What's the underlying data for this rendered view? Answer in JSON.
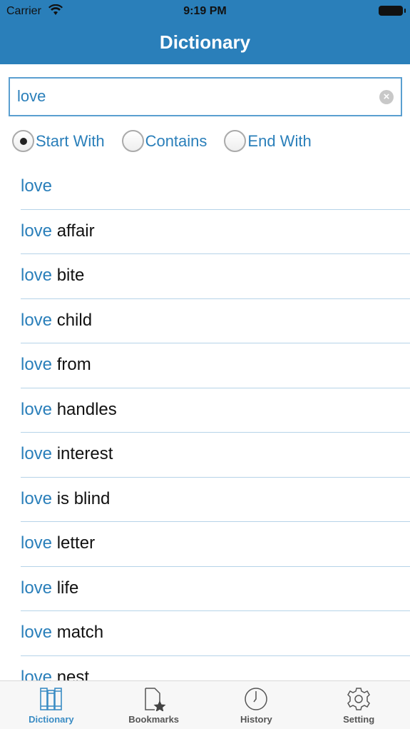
{
  "status": {
    "carrier": "Carrier",
    "time": "9:19 PM"
  },
  "header": {
    "title": "Dictionary"
  },
  "search": {
    "value": "love"
  },
  "filters": [
    {
      "label": "Start With",
      "selected": true
    },
    {
      "label": "Contains",
      "selected": false
    },
    {
      "label": "End With",
      "selected": false
    }
  ],
  "results": [
    {
      "prefix": "love",
      "rest": ""
    },
    {
      "prefix": "love",
      "rest": " affair"
    },
    {
      "prefix": "love",
      "rest": " bite"
    },
    {
      "prefix": "love",
      "rest": " child"
    },
    {
      "prefix": "love",
      "rest": " from"
    },
    {
      "prefix": "love",
      "rest": " handles"
    },
    {
      "prefix": "love",
      "rest": " interest"
    },
    {
      "prefix": "love",
      "rest": " is blind"
    },
    {
      "prefix": "love",
      "rest": " letter"
    },
    {
      "prefix": "love",
      "rest": " life"
    },
    {
      "prefix": "love",
      "rest": " match"
    },
    {
      "prefix": "love",
      "rest": " nest"
    }
  ],
  "tabs": [
    {
      "label": "Dictionary",
      "icon": "books-icon",
      "active": true
    },
    {
      "label": "Bookmarks",
      "icon": "bookmark-star-icon"
    },
    {
      "label": "History",
      "icon": "clock-icon"
    },
    {
      "label": "Setting",
      "icon": "gear-icon"
    }
  ],
  "colors": {
    "accent": "#2a7fba"
  }
}
